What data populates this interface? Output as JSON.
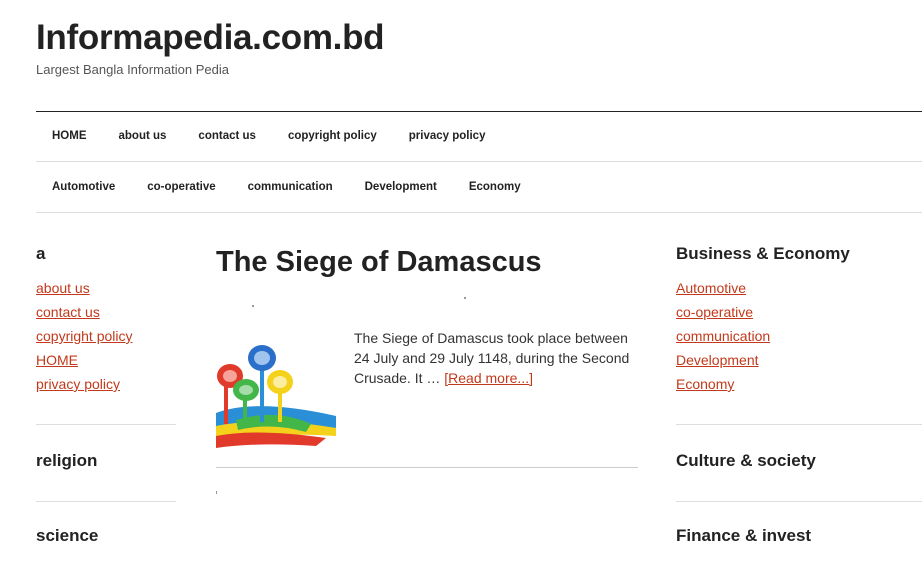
{
  "site": {
    "title": "Informapedia.com.bd",
    "tagline": "Largest Bangla Information Pedia"
  },
  "nav_primary": [
    "HOME",
    "about us",
    "contact us",
    "copyright policy",
    "privacy policy"
  ],
  "nav_secondary": [
    "Automotive",
    "co-operative",
    "communication",
    "Development",
    "Economy"
  ],
  "left_sidebar": {
    "widget_a": {
      "title": "a",
      "links": [
        "about us",
        "contact us",
        "copyright policy",
        "HOME",
        "privacy policy"
      ]
    },
    "religion_title": "religion",
    "science_title": "science"
  },
  "right_sidebar": {
    "business": {
      "title": "Business & Economy",
      "links": [
        "Automotive",
        "co-operative",
        "communication",
        "Development",
        "Economy"
      ]
    },
    "culture_title": "Culture & society",
    "finance_title": "Finance & invest"
  },
  "post": {
    "title": "The Siege of Damascus",
    "excerpt": "The Siege of Damascus took place between 24 July and 29 July 1148, during the Second Crusade. It … ",
    "read_more": "[Read more...]"
  },
  "colors": {
    "link": "#c2391b",
    "text": "#222222",
    "separator": "#dddddd"
  }
}
